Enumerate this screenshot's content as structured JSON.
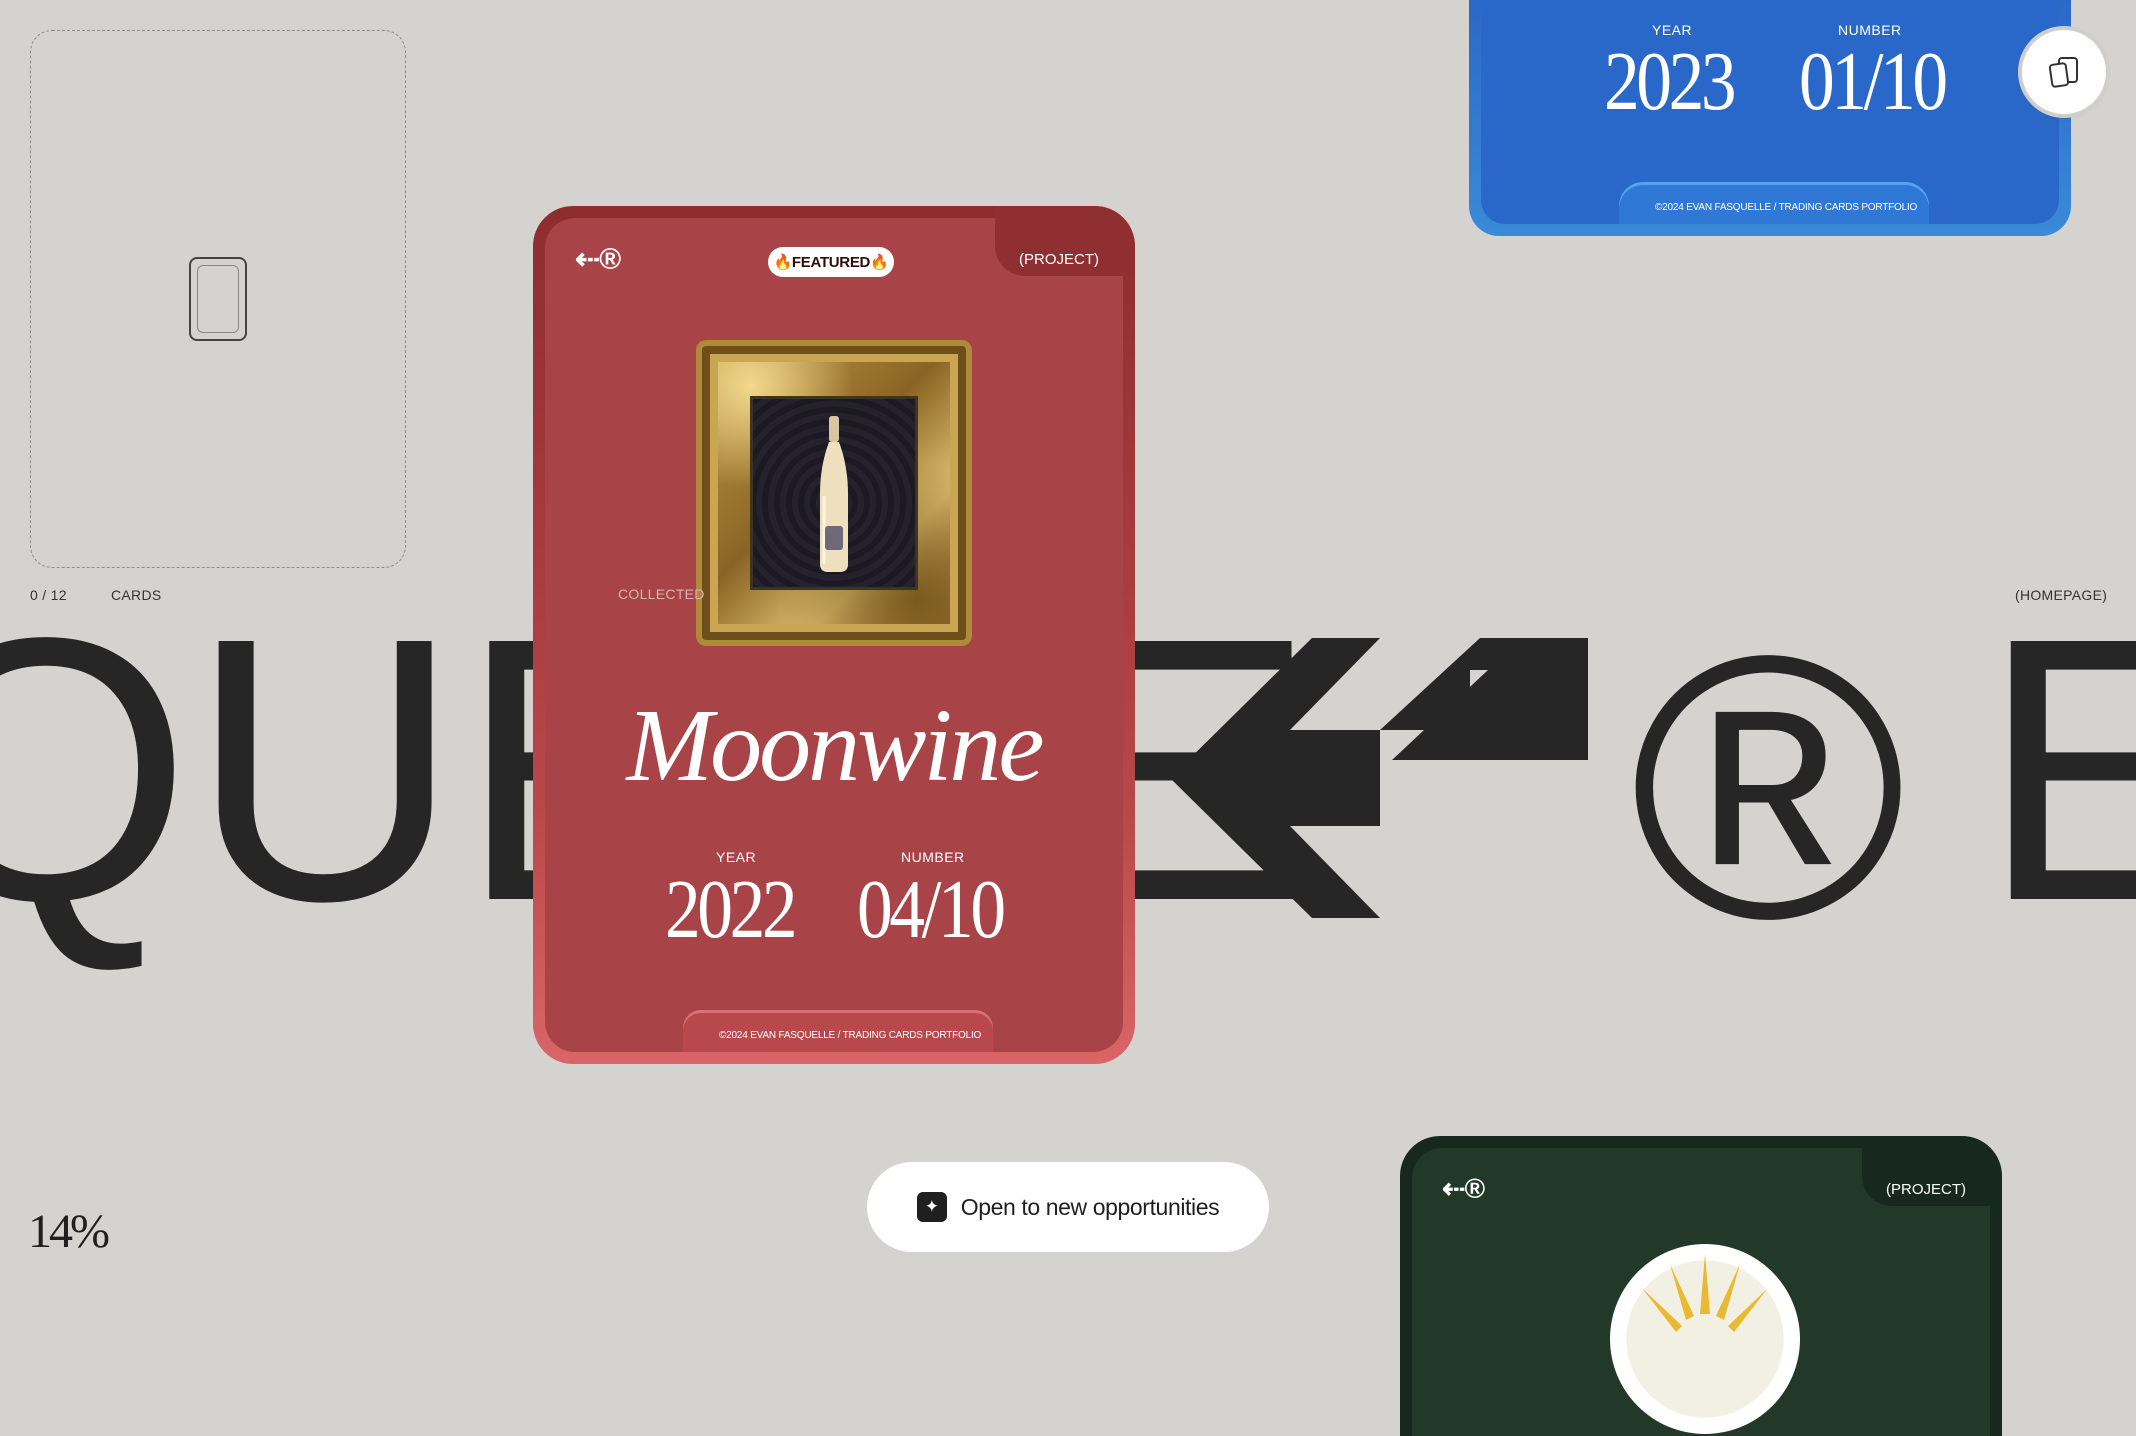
{
  "placeholder": {
    "counter": "0 / 12",
    "label": "CARDS"
  },
  "homepage_link": "(HOMEPAGE)",
  "marquee": {
    "left_text": "QUE",
    "right_text": "E",
    "logo_reg": "®",
    "right_tail": "E"
  },
  "featured_card": {
    "logo": "⇠®",
    "badge": "🔥FEATURED🔥",
    "tag": "(PROJECT)",
    "collected": "COLLECTED",
    "title": "Moonwine",
    "year_label": "YEAR",
    "year": "2022",
    "number_label": "NUMBER",
    "number": "04/10",
    "copyright": "©2024 EVAN FASQUELLE / TRADING CARDS PORTFOLIO"
  },
  "top_card": {
    "year_label": "YEAR",
    "year": "2023",
    "number_label": "NUMBER",
    "number": "01/10",
    "copyright": "©2024 EVAN FASQUELLE / TRADING CARDS PORTFOLIO"
  },
  "bottom_card": {
    "logo": "⇠®",
    "tag": "(PROJECT)"
  },
  "cta": {
    "label": "Open to new opportunities",
    "icon": "sparkle-icon"
  },
  "progress": {
    "label": "14%",
    "value": 14
  },
  "icons": {
    "cards_button": "cards-stack-icon"
  },
  "colors": {
    "background": "#d4d3cf",
    "featured_card": "#a84347",
    "top_card": "#2968c8",
    "bottom_card": "#22392a"
  }
}
